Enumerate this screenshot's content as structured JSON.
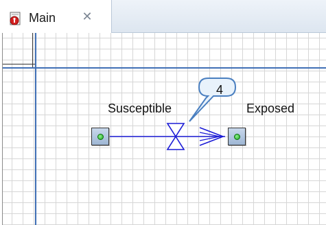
{
  "tab": {
    "label": "Main",
    "icon": "model-icon",
    "close_icon": "close-icon",
    "close_glyph": "✕"
  },
  "diagram": {
    "stocks": [
      {
        "name": "Susceptible",
        "icon": "stock-icon"
      },
      {
        "name": "Exposed",
        "icon": "stock-icon"
      }
    ],
    "flow": {
      "icon": "valve-icon"
    },
    "callout": {
      "number": "4"
    }
  },
  "colors": {
    "axis": "#3f6fb5",
    "flow": "#1b1bd6",
    "callout_border": "#4a7fc0",
    "callout_fill": "#e8f2fb"
  }
}
